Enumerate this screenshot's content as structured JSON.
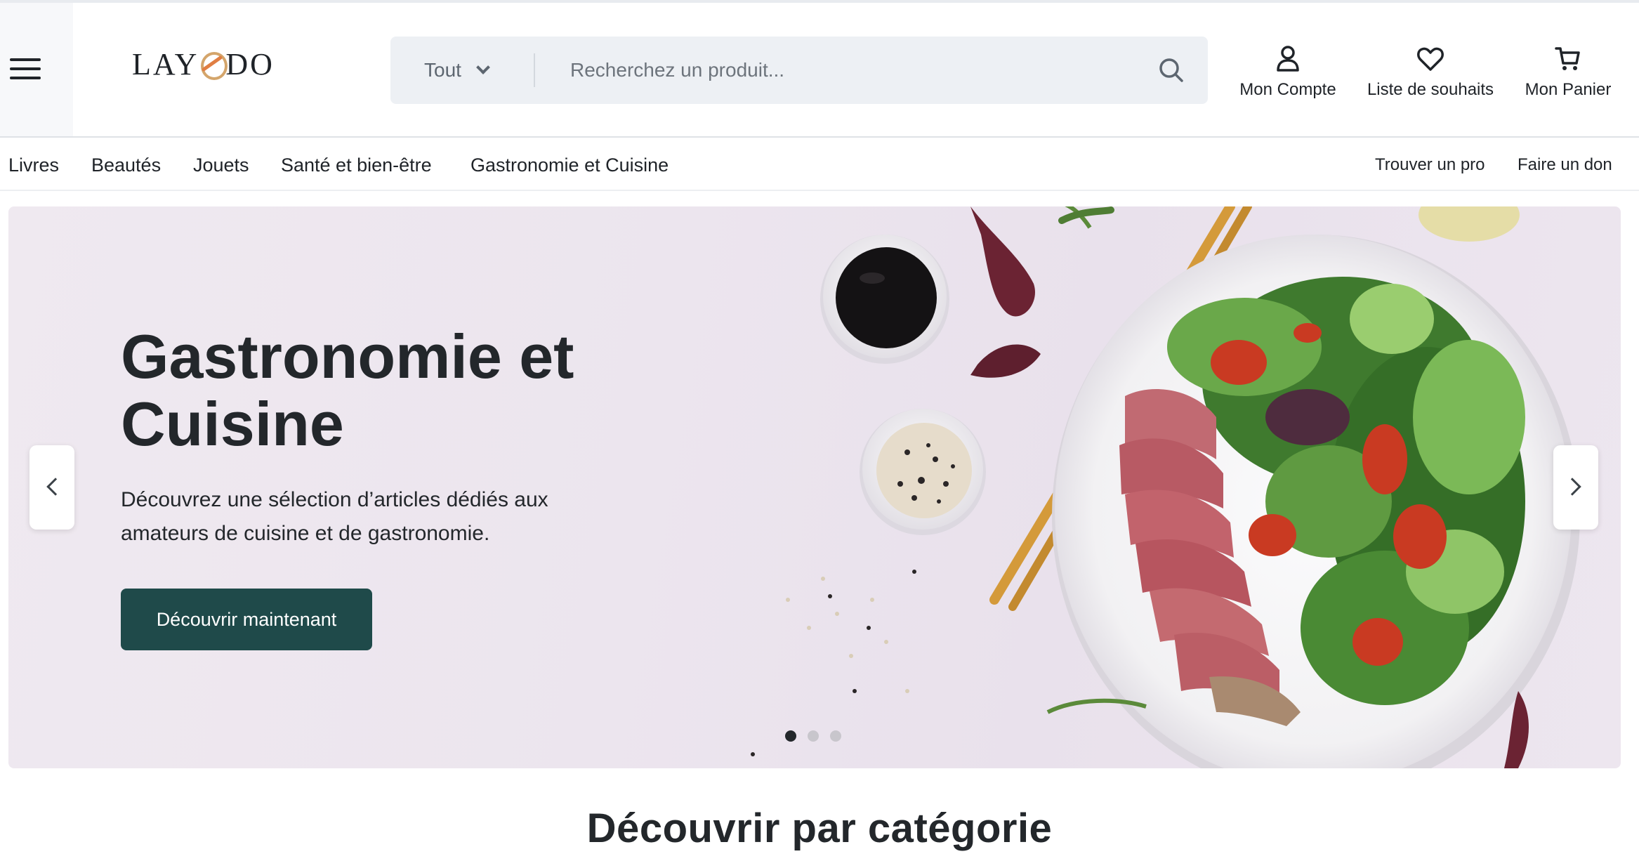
{
  "brand": {
    "logo_text_left": "LAY",
    "logo_text_right": "DO"
  },
  "header": {
    "search": {
      "scope": "Tout",
      "placeholder": "Recherchez un produit..."
    },
    "actions": {
      "account": "Mon Compte",
      "wishlist": "Liste de souhaits",
      "cart": "Mon Panier"
    }
  },
  "nav": {
    "categories": [
      "Livres",
      "Beautés",
      "Jouets",
      "Santé et bien-être",
      "Gastronomie et Cuisine"
    ],
    "links": [
      "Trouver un pro",
      "Faire un don"
    ]
  },
  "hero": {
    "title": "Gastronomie et Cuisine",
    "description": "Découvrez une sélection d’articles dédiés aux amateurs de cuisine et de gastronomie.",
    "cta": "Découvrir maintenant",
    "slides_total": 3,
    "active_slide": 1
  },
  "section": {
    "title": "Découvrir par catégorie"
  },
  "colors": {
    "cta_bg": "#1f4a4a",
    "search_bg": "#edf0f4",
    "text": "#1f2328"
  },
  "icons": [
    "menu-icon",
    "chevron-down-icon",
    "search-icon",
    "user-icon",
    "heart-icon",
    "cart-icon",
    "chevron-left-icon",
    "chevron-right-icon"
  ]
}
